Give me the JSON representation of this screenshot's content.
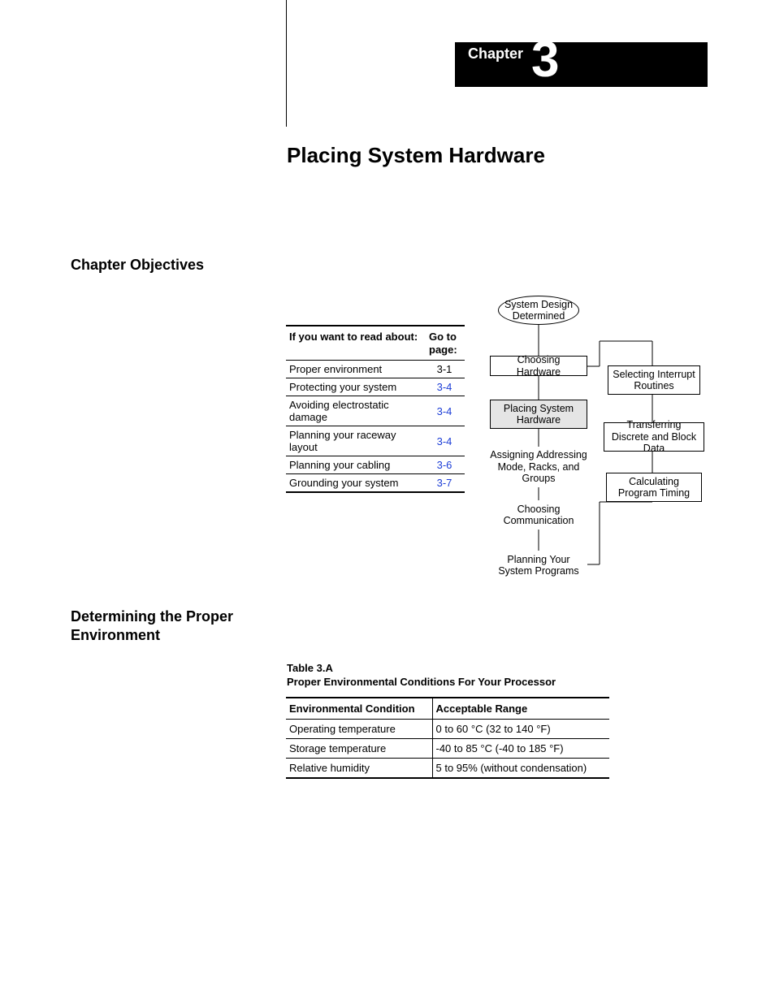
{
  "chapter": {
    "label": "Chapter",
    "number": "3",
    "title": "Placing System Hardware"
  },
  "sections": {
    "objectives": "Chapter Objectives",
    "environment": "Determining the Proper Environment"
  },
  "toc": {
    "headers": {
      "topic": "If you want to read about:",
      "page": "Go to page:"
    },
    "rows": [
      {
        "topic": "Proper environment",
        "page": "3-1",
        "link": false
      },
      {
        "topic": "Protecting your system",
        "page": "3-4",
        "link": true
      },
      {
        "topic": "Avoiding electrostatic damage",
        "page": "3-4",
        "link": true
      },
      {
        "topic": "Planning your raceway layout",
        "page": "3-4",
        "link": true
      },
      {
        "topic": "Planning your cabling",
        "page": "3-6",
        "link": true
      },
      {
        "topic": "Grounding your system",
        "page": "3-7",
        "link": true
      }
    ]
  },
  "flow": {
    "start": "System Design Determined",
    "col1": [
      "Choosing Hardware",
      "Placing System Hardware",
      "Assigning Addressing Mode, Racks, and Groups",
      "Choosing Communication",
      "Planning Your System Programs"
    ],
    "col2": [
      "Selecting Interrupt Routines",
      "Transferring Discrete and Block Data",
      "Calculating Program Timing"
    ]
  },
  "envTable": {
    "captionA": "Table 3.A",
    "captionB": "Proper Environmental Conditions For Your Processor",
    "headers": {
      "cond": "Environmental Condition",
      "range": "Acceptable Range"
    },
    "rows": [
      {
        "cond": "Operating temperature",
        "range": "0 to 60 °C (32 to 140 °F)"
      },
      {
        "cond": "Storage temperature",
        "range": "-40 to 85 °C (-40 to 185 °F)"
      },
      {
        "cond": "Relative humidity",
        "range": "5 to 95% (without condensation)"
      }
    ]
  }
}
